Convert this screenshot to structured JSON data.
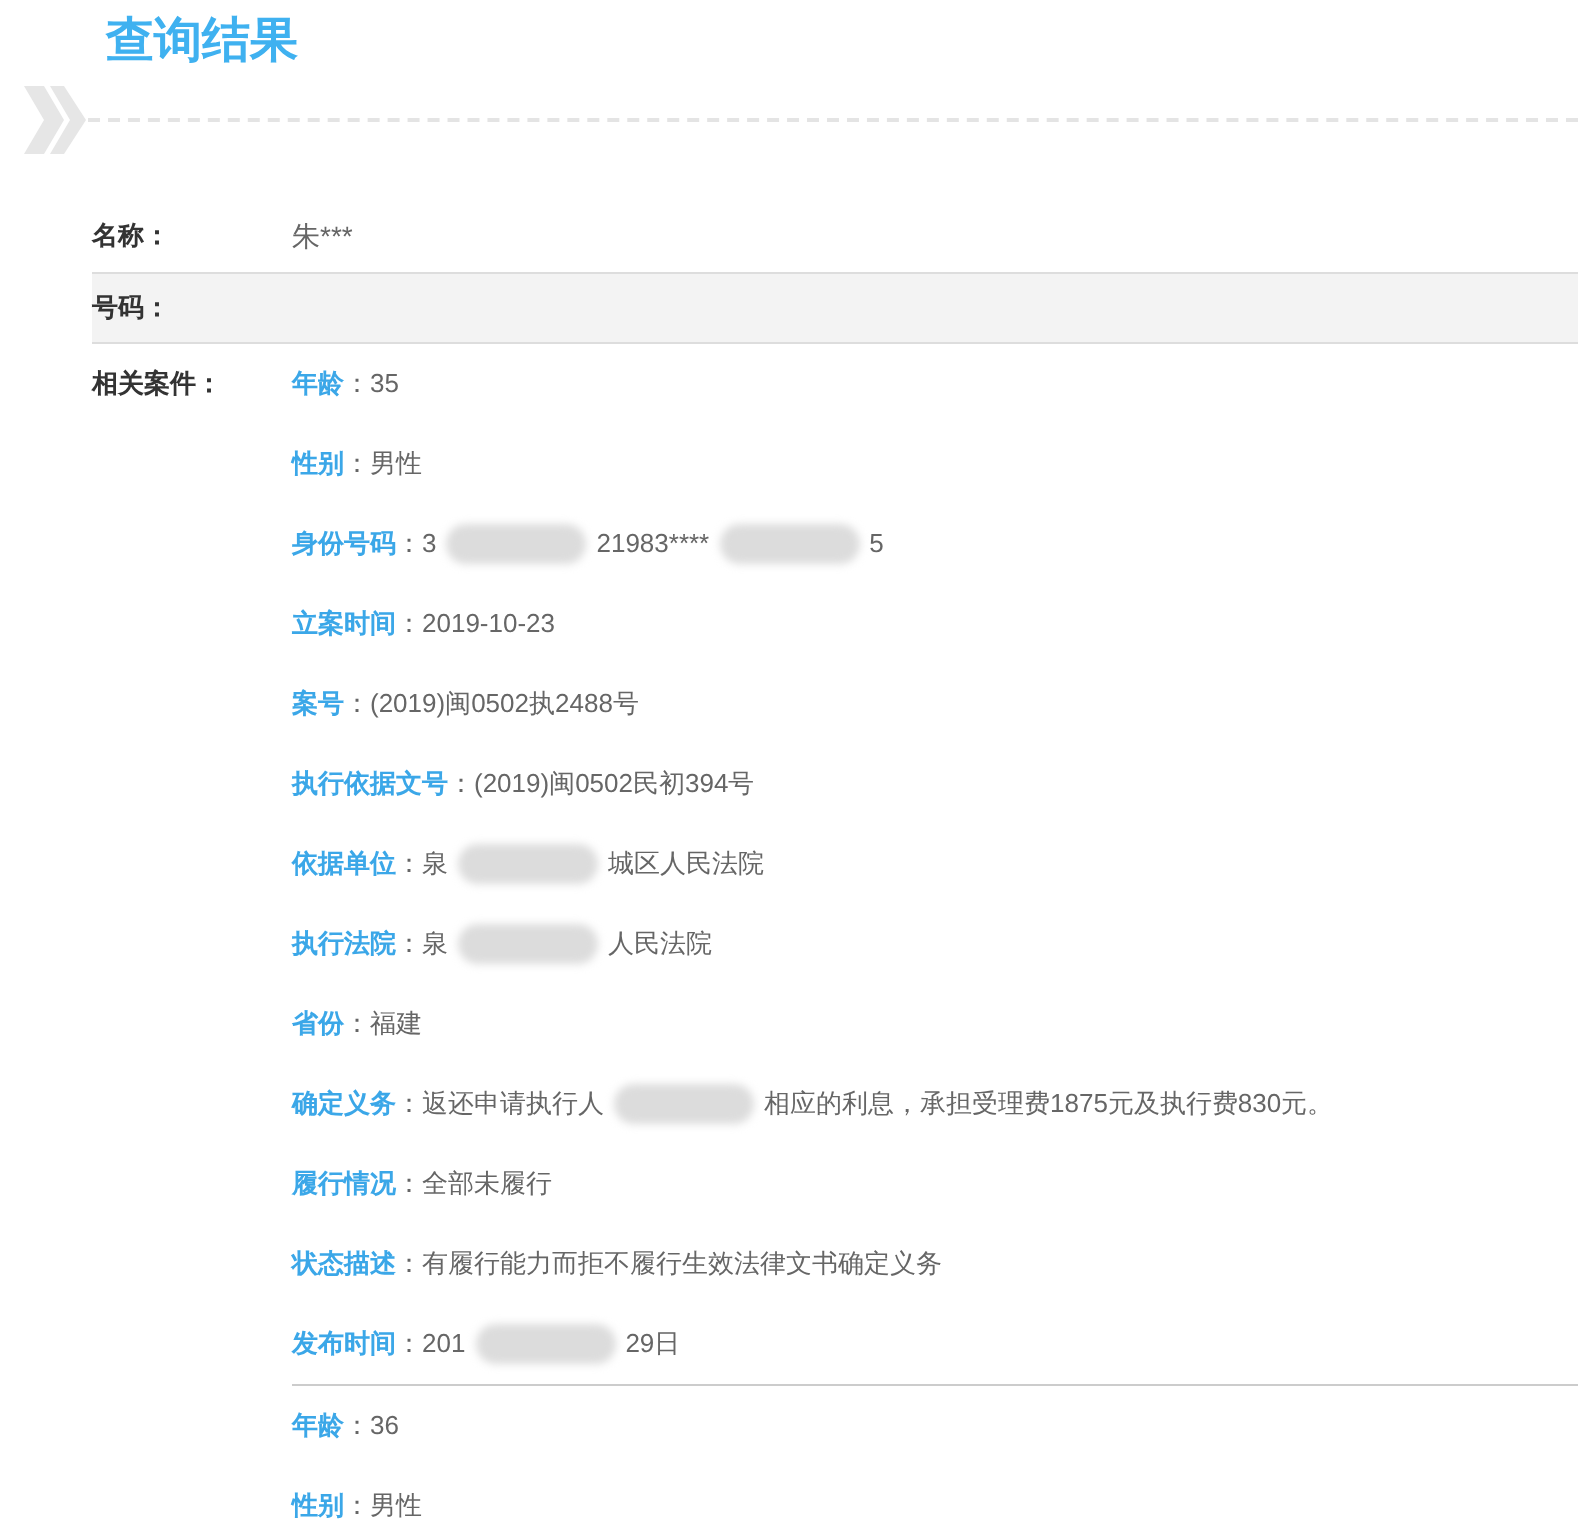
{
  "title": "查询结果",
  "fields": [
    {
      "label": "名称：",
      "value": "朱***",
      "shaded": false
    },
    {
      "label": "号码：",
      "shaded": true
    }
  ],
  "cases_label": "相关案件：",
  "cases": [
    {
      "items": [
        {
          "label": "年龄",
          "parts": [
            {
              "kind": "text",
              "text": "：35"
            }
          ]
        },
        {
          "label": "性别",
          "parts": [
            {
              "kind": "text",
              "text": "：男性"
            }
          ]
        },
        {
          "label": "身份号码",
          "parts": [
            {
              "kind": "text",
              "text": "：3"
            },
            {
              "kind": "blur"
            },
            {
              "kind": "text",
              "text": "21983****"
            },
            {
              "kind": "blur"
            },
            {
              "kind": "text",
              "text": "5"
            }
          ]
        },
        {
          "label": "立案时间",
          "parts": [
            {
              "kind": "text",
              "text": "：2019-10-23"
            }
          ]
        },
        {
          "label": "案号",
          "parts": [
            {
              "kind": "text",
              "text": "：(2019)闽0502执2488号"
            }
          ]
        },
        {
          "label": "执行依据文号",
          "parts": [
            {
              "kind": "text",
              "text": "：(2019)闽0502民初394号"
            }
          ]
        },
        {
          "label": "依据单位",
          "parts": [
            {
              "kind": "text",
              "text": "：泉"
            },
            {
              "kind": "blur"
            },
            {
              "kind": "text",
              "text": "城区人民法院"
            }
          ]
        },
        {
          "label": "执行法院",
          "parts": [
            {
              "kind": "text",
              "text": "：泉"
            },
            {
              "kind": "blur"
            },
            {
              "kind": "text",
              "text": "人民法院"
            }
          ]
        },
        {
          "label": "省份",
          "parts": [
            {
              "kind": "text",
              "text": "：福建"
            }
          ]
        },
        {
          "label": "确定义务",
          "parts": [
            {
              "kind": "text",
              "text": "：返还申请执行人"
            },
            {
              "kind": "blur"
            },
            {
              "kind": "text",
              "text": "相应的利息，承担受理费1875元及执行费830元。"
            }
          ]
        },
        {
          "label": "履行情况",
          "parts": [
            {
              "kind": "text",
              "text": "：全部未履行"
            }
          ]
        },
        {
          "label": "状态描述",
          "parts": [
            {
              "kind": "text",
              "text": "：有履行能力而拒不履行生效法律文书确定义务"
            }
          ]
        },
        {
          "label": "发布时间",
          "parts": [
            {
              "kind": "text",
              "text": "：201"
            },
            {
              "kind": "blur"
            },
            {
              "kind": "text",
              "text": "29日"
            }
          ]
        }
      ]
    },
    {
      "items": [
        {
          "label": "年龄",
          "parts": [
            {
              "kind": "text",
              "text": "：36"
            }
          ]
        },
        {
          "label": "性别",
          "parts": [
            {
              "kind": "text",
              "text": "：男性"
            }
          ]
        }
      ]
    }
  ]
}
